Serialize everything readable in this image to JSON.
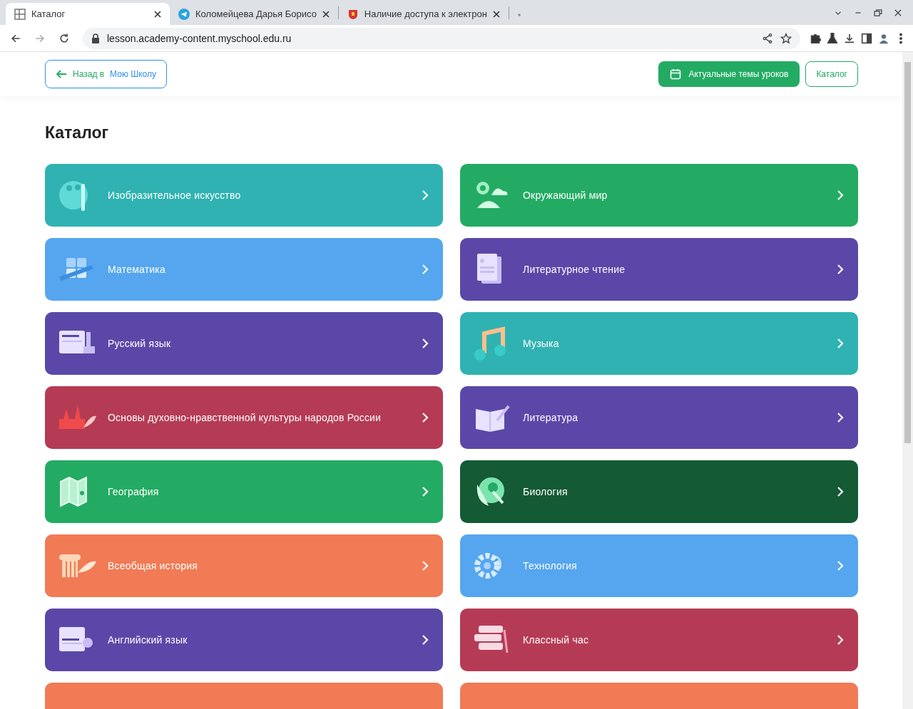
{
  "browser": {
    "tabs": [
      {
        "title": "Каталог",
        "selected": true
      },
      {
        "title": "Коломейцева Дарья Борисо",
        "selected": false
      },
      {
        "title": "Наличие доступа к электрон",
        "selected": false
      }
    ],
    "address": "lesson.academy-content.myschool.edu.ru"
  },
  "header": {
    "back_button": {
      "prefix": "Назад в",
      "label": "Мою Школу"
    },
    "topics_button": "Актуальные темы уроков",
    "catalog_button": "Каталог"
  },
  "page_title": "Каталог",
  "subjects": [
    {
      "title": "Изобразительное искусство",
      "color": "#30b2b2"
    },
    {
      "title": "Окружающий мир",
      "color": "#23ab63"
    },
    {
      "title": "Математика",
      "color": "#55a6ef"
    },
    {
      "title": "Литературное чтение",
      "color": "#5b47a8"
    },
    {
      "title": "Русский язык",
      "color": "#5b47a8"
    },
    {
      "title": "Музыка",
      "color": "#30b2b2"
    },
    {
      "title": "Основы духовно-нравственной культуры народов России",
      "color": "#b53b54"
    },
    {
      "title": "Литература",
      "color": "#5b47a8"
    },
    {
      "title": "География",
      "color": "#23ab63"
    },
    {
      "title": "Биология",
      "color": "#135a35"
    },
    {
      "title": "Всеобщая история",
      "color": "#f07b55"
    },
    {
      "title": "Технология",
      "color": "#55a6ef"
    },
    {
      "title": "Английский язык",
      "color": "#5b47a8"
    },
    {
      "title": "Классный час",
      "color": "#b53b54"
    },
    {
      "color": "#f07b55"
    },
    {
      "color": "#f07b55"
    }
  ]
}
